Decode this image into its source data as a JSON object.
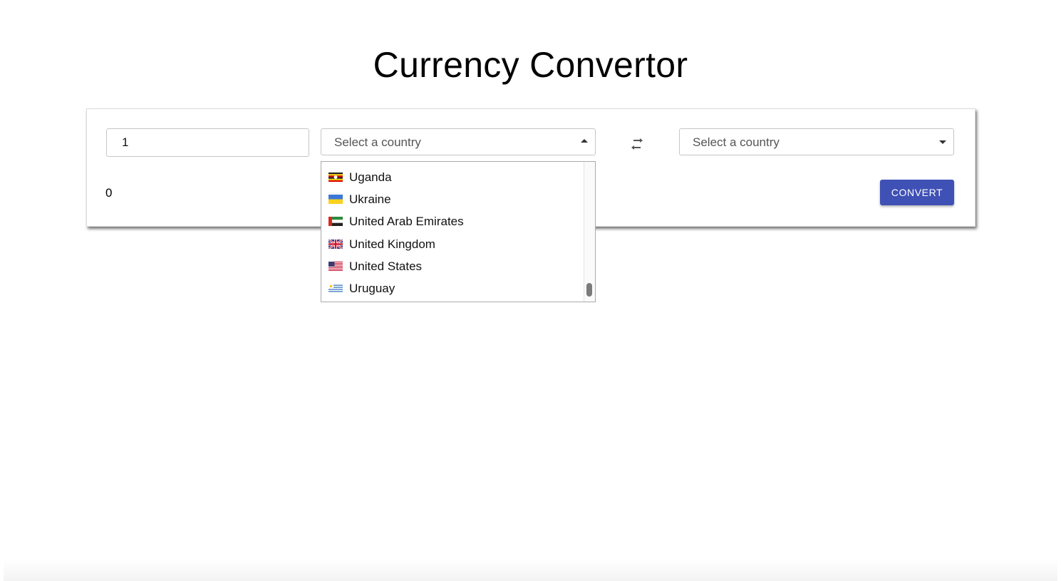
{
  "title": "Currency Convertor",
  "amount": {
    "value": "1"
  },
  "from_select": {
    "placeholder": "Select a country",
    "open": true
  },
  "to_select": {
    "placeholder": "Select a country",
    "open": false
  },
  "swap": {
    "icon": "swap-arrows-icon"
  },
  "result": {
    "value": "0"
  },
  "convert_button": {
    "label": "CONVERT",
    "color": "#3f51b5"
  },
  "dropdown": {
    "options": [
      {
        "label": "Uganda",
        "flag": "uganda-flag-icon"
      },
      {
        "label": "Ukraine",
        "flag": "ukraine-flag-icon"
      },
      {
        "label": "United Arab Emirates",
        "flag": "uae-flag-icon"
      },
      {
        "label": "United Kingdom",
        "flag": "uk-flag-icon"
      },
      {
        "label": "United States",
        "flag": "us-flag-icon"
      },
      {
        "label": "Uruguay",
        "flag": "uruguay-flag-icon"
      }
    ]
  }
}
